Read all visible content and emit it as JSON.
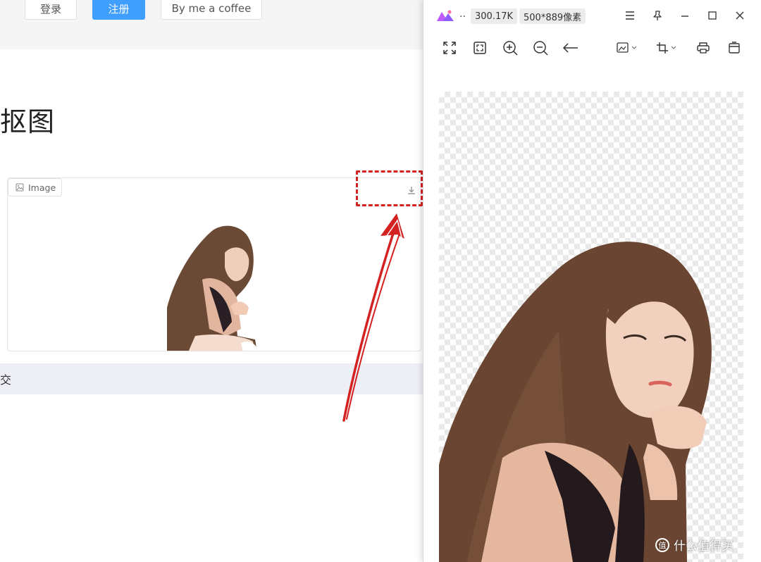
{
  "web": {
    "header": {
      "login_label": "登录",
      "register_label": "注册",
      "coffee_label": "By me a coffee"
    },
    "page_title": "抠图",
    "image_panel": {
      "label": "Image"
    },
    "submit_label": "交"
  },
  "viewer": {
    "ellipsis": "..",
    "file_size": "300.17K",
    "dimensions": "500*889像素"
  },
  "watermark": {
    "text": "什么值得买"
  },
  "colors": {
    "primary_button": "#409eff",
    "highlight": "#d42121",
    "submit_bar_bg": "#eeeff6"
  }
}
